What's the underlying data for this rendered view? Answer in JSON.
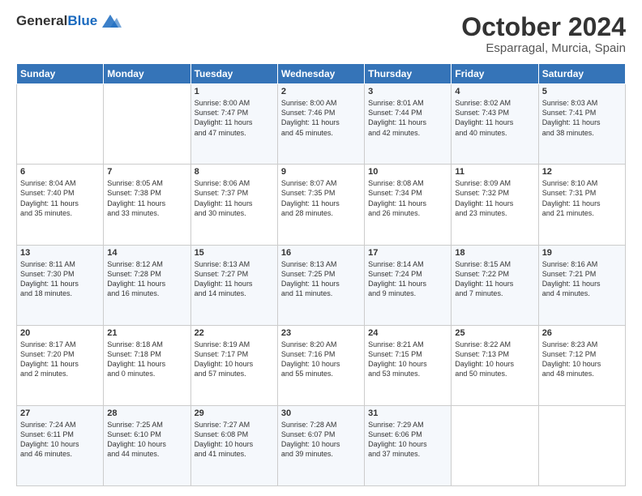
{
  "header": {
    "logo_general": "General",
    "logo_blue": "Blue",
    "month_title": "October 2024",
    "location": "Esparragal, Murcia, Spain"
  },
  "days_of_week": [
    "Sunday",
    "Monday",
    "Tuesday",
    "Wednesday",
    "Thursday",
    "Friday",
    "Saturday"
  ],
  "weeks": [
    [
      {
        "day": "",
        "content": ""
      },
      {
        "day": "",
        "content": ""
      },
      {
        "day": "1",
        "content": "Sunrise: 8:00 AM\nSunset: 7:47 PM\nDaylight: 11 hours\nand 47 minutes."
      },
      {
        "day": "2",
        "content": "Sunrise: 8:00 AM\nSunset: 7:46 PM\nDaylight: 11 hours\nand 45 minutes."
      },
      {
        "day": "3",
        "content": "Sunrise: 8:01 AM\nSunset: 7:44 PM\nDaylight: 11 hours\nand 42 minutes."
      },
      {
        "day": "4",
        "content": "Sunrise: 8:02 AM\nSunset: 7:43 PM\nDaylight: 11 hours\nand 40 minutes."
      },
      {
        "day": "5",
        "content": "Sunrise: 8:03 AM\nSunset: 7:41 PM\nDaylight: 11 hours\nand 38 minutes."
      }
    ],
    [
      {
        "day": "6",
        "content": "Sunrise: 8:04 AM\nSunset: 7:40 PM\nDaylight: 11 hours\nand 35 minutes."
      },
      {
        "day": "7",
        "content": "Sunrise: 8:05 AM\nSunset: 7:38 PM\nDaylight: 11 hours\nand 33 minutes."
      },
      {
        "day": "8",
        "content": "Sunrise: 8:06 AM\nSunset: 7:37 PM\nDaylight: 11 hours\nand 30 minutes."
      },
      {
        "day": "9",
        "content": "Sunrise: 8:07 AM\nSunset: 7:35 PM\nDaylight: 11 hours\nand 28 minutes."
      },
      {
        "day": "10",
        "content": "Sunrise: 8:08 AM\nSunset: 7:34 PM\nDaylight: 11 hours\nand 26 minutes."
      },
      {
        "day": "11",
        "content": "Sunrise: 8:09 AM\nSunset: 7:32 PM\nDaylight: 11 hours\nand 23 minutes."
      },
      {
        "day": "12",
        "content": "Sunrise: 8:10 AM\nSunset: 7:31 PM\nDaylight: 11 hours\nand 21 minutes."
      }
    ],
    [
      {
        "day": "13",
        "content": "Sunrise: 8:11 AM\nSunset: 7:30 PM\nDaylight: 11 hours\nand 18 minutes."
      },
      {
        "day": "14",
        "content": "Sunrise: 8:12 AM\nSunset: 7:28 PM\nDaylight: 11 hours\nand 16 minutes."
      },
      {
        "day": "15",
        "content": "Sunrise: 8:13 AM\nSunset: 7:27 PM\nDaylight: 11 hours\nand 14 minutes."
      },
      {
        "day": "16",
        "content": "Sunrise: 8:13 AM\nSunset: 7:25 PM\nDaylight: 11 hours\nand 11 minutes."
      },
      {
        "day": "17",
        "content": "Sunrise: 8:14 AM\nSunset: 7:24 PM\nDaylight: 11 hours\nand 9 minutes."
      },
      {
        "day": "18",
        "content": "Sunrise: 8:15 AM\nSunset: 7:22 PM\nDaylight: 11 hours\nand 7 minutes."
      },
      {
        "day": "19",
        "content": "Sunrise: 8:16 AM\nSunset: 7:21 PM\nDaylight: 11 hours\nand 4 minutes."
      }
    ],
    [
      {
        "day": "20",
        "content": "Sunrise: 8:17 AM\nSunset: 7:20 PM\nDaylight: 11 hours\nand 2 minutes."
      },
      {
        "day": "21",
        "content": "Sunrise: 8:18 AM\nSunset: 7:18 PM\nDaylight: 11 hours\nand 0 minutes."
      },
      {
        "day": "22",
        "content": "Sunrise: 8:19 AM\nSunset: 7:17 PM\nDaylight: 10 hours\nand 57 minutes."
      },
      {
        "day": "23",
        "content": "Sunrise: 8:20 AM\nSunset: 7:16 PM\nDaylight: 10 hours\nand 55 minutes."
      },
      {
        "day": "24",
        "content": "Sunrise: 8:21 AM\nSunset: 7:15 PM\nDaylight: 10 hours\nand 53 minutes."
      },
      {
        "day": "25",
        "content": "Sunrise: 8:22 AM\nSunset: 7:13 PM\nDaylight: 10 hours\nand 50 minutes."
      },
      {
        "day": "26",
        "content": "Sunrise: 8:23 AM\nSunset: 7:12 PM\nDaylight: 10 hours\nand 48 minutes."
      }
    ],
    [
      {
        "day": "27",
        "content": "Sunrise: 7:24 AM\nSunset: 6:11 PM\nDaylight: 10 hours\nand 46 minutes."
      },
      {
        "day": "28",
        "content": "Sunrise: 7:25 AM\nSunset: 6:10 PM\nDaylight: 10 hours\nand 44 minutes."
      },
      {
        "day": "29",
        "content": "Sunrise: 7:27 AM\nSunset: 6:08 PM\nDaylight: 10 hours\nand 41 minutes."
      },
      {
        "day": "30",
        "content": "Sunrise: 7:28 AM\nSunset: 6:07 PM\nDaylight: 10 hours\nand 39 minutes."
      },
      {
        "day": "31",
        "content": "Sunrise: 7:29 AM\nSunset: 6:06 PM\nDaylight: 10 hours\nand 37 minutes."
      },
      {
        "day": "",
        "content": ""
      },
      {
        "day": "",
        "content": ""
      }
    ]
  ]
}
